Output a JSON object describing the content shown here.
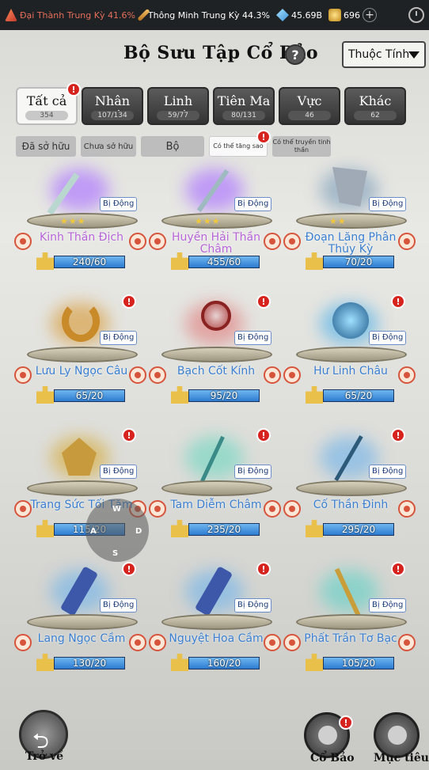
{
  "status": {
    "realm": "Đại Thành Trung Kỳ 41.6%",
    "intellect": "Thông Minh Trung Kỳ 44.3%",
    "crystals": "45.69B",
    "coins": "696"
  },
  "header": {
    "title": "Bộ Sưu Tập Cổ Bảo",
    "help": "?",
    "attribute_select": "Thuộc Tính"
  },
  "tabs": [
    {
      "label": "Tất cả",
      "count": "354",
      "active": true,
      "badge": true
    },
    {
      "label": "Nhân Giới",
      "count": "107/134"
    },
    {
      "label": "Linh Giới",
      "count": "59/77"
    },
    {
      "label": "Tiên Ma",
      "count": "80/131"
    },
    {
      "label": "Vực",
      "count": "46"
    },
    {
      "label": "Khác",
      "count": "62"
    }
  ],
  "filters": {
    "owned": "Đã sở hữu",
    "not_owned": "Chưa sở hữu",
    "set": "Bộ",
    "can_upgrade": "Có thể tăng sao",
    "can_transfer": "Có thể truyền tinh thần"
  },
  "passive_label": "Bị Động",
  "treasures": [
    {
      "name": "Kinh Thần Địch",
      "progress": "240/60",
      "fill": 1.0,
      "stars": 3,
      "color": "purple",
      "art": "flute",
      "badge": false
    },
    {
      "name": "Huyền Hải Thần Châm",
      "progress": "455/60",
      "fill": 1.0,
      "stars": 3,
      "color": "purple",
      "art": "needle",
      "badge": false
    },
    {
      "name": "Đoạn Lăng Phân Thủy Kỳ",
      "progress": "70/20",
      "fill": 1.0,
      "stars": 2,
      "color": "blue",
      "art": "flag",
      "badge": false
    },
    {
      "name": "Lưu Ly Ngọc Câu",
      "progress": "65/20",
      "fill": 1.0,
      "stars": 0,
      "color": "blue",
      "art": "hook",
      "badge": true
    },
    {
      "name": "Bạch Cốt Kính",
      "progress": "95/20",
      "fill": 1.0,
      "stars": 0,
      "color": "blue",
      "art": "mirror",
      "badge": true
    },
    {
      "name": "Hư Linh Châu",
      "progress": "65/20",
      "fill": 1.0,
      "stars": 0,
      "color": "blue",
      "art": "orb",
      "badge": true
    },
    {
      "name": "Trang Sức Tối Tăm",
      "progress": "115/20",
      "fill": 1.0,
      "stars": 0,
      "color": "blue",
      "art": "ornament",
      "badge": true
    },
    {
      "name": "Tam Diễm Châm",
      "progress": "235/20",
      "fill": 1.0,
      "stars": 0,
      "color": "blue",
      "art": "needles",
      "badge": true
    },
    {
      "name": "Cố Thần Đinh",
      "progress": "295/20",
      "fill": 1.0,
      "stars": 0,
      "color": "blue",
      "art": "nail",
      "badge": true
    },
    {
      "name": "Lang Ngọc Cầm",
      "progress": "130/20",
      "fill": 1.0,
      "stars": 0,
      "color": "blue",
      "art": "zither",
      "badge": true
    },
    {
      "name": "Nguyệt Hoa Cầm",
      "progress": "160/20",
      "fill": 1.0,
      "stars": 0,
      "color": "blue",
      "art": "zither",
      "badge": true
    },
    {
      "name": "Phất Trần Tơ Bạc",
      "progress": "105/20",
      "fill": 1.0,
      "stars": 0,
      "color": "blue",
      "art": "whisk",
      "badge": true
    }
  ],
  "bottom": {
    "back": "Trở về",
    "treasure": "Cổ Bảo",
    "target": "Mục tiêu"
  },
  "joystick": {
    "up": "W",
    "left": "A",
    "right": "D",
    "down": "S"
  }
}
